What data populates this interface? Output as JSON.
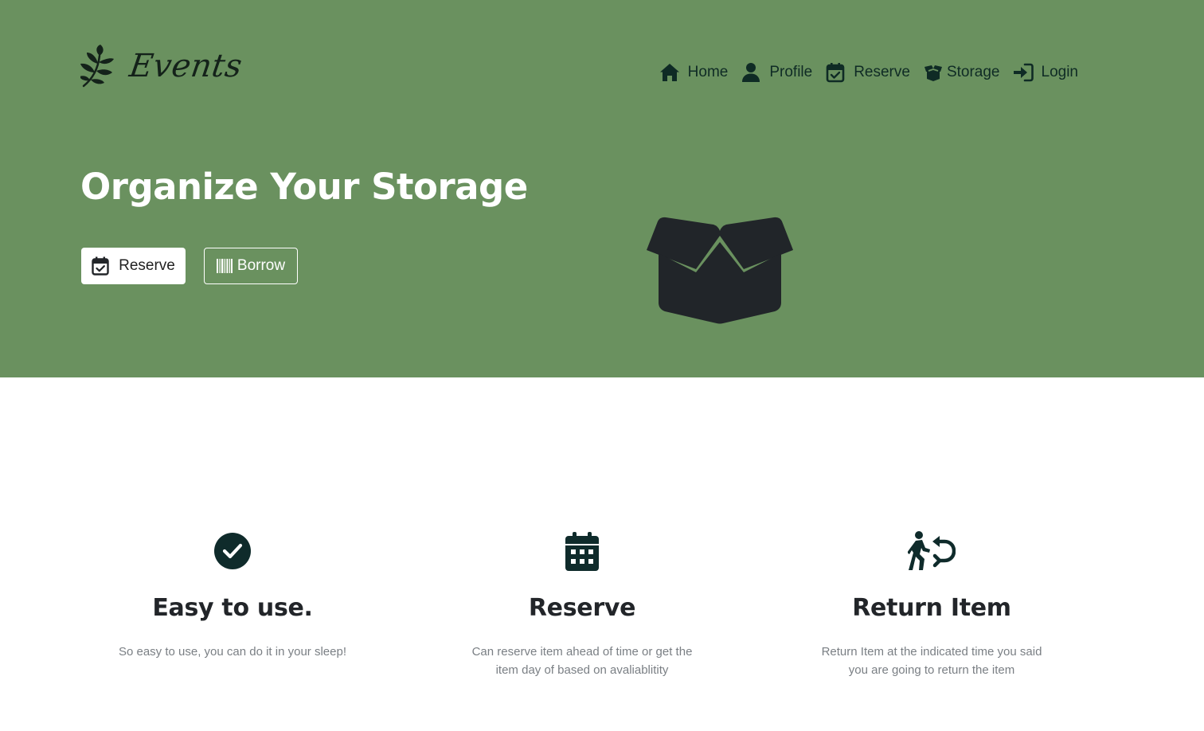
{
  "colors": {
    "hero_bg": "#6a915f",
    "nav_text": "#0f2b25",
    "hero_title": "#ffffff",
    "box_icon": "#212529",
    "feature_icon": "#0f2b2b",
    "feature_title": "#222529",
    "feature_text": "#7a7f84"
  },
  "brand": {
    "name": "Events",
    "icon": "leaf-sprig-icon"
  },
  "nav": {
    "items": [
      {
        "label": "Home",
        "icon": "home-icon"
      },
      {
        "label": "Profile",
        "icon": "user-icon"
      },
      {
        "label": "Reserve",
        "icon": "calendar-check-icon"
      },
      {
        "label": "Storage",
        "icon": "box-open-icon"
      },
      {
        "label": "Login",
        "icon": "sign-in-icon"
      }
    ]
  },
  "hero": {
    "title": "Organize Your Storage",
    "reserve_button": {
      "label": "Reserve",
      "icon": "calendar-check-icon"
    },
    "borrow_button": {
      "label": "Borrow",
      "icon": "barcode-icon"
    },
    "illustration": "box-open-icon"
  },
  "features": [
    {
      "icon": "circle-check-icon",
      "title": "Easy to use.",
      "text": "So easy to use, you can do it in your sleep!"
    },
    {
      "icon": "calendar-days-icon",
      "title": "Reserve",
      "text": "Can reserve item ahead of time or get the item day of based on avaliablitity"
    },
    {
      "icon": "person-walking-arrow-return-icon",
      "title": "Return Item",
      "text": "Return Item at the indicated time you said you are going to return the item"
    }
  ]
}
